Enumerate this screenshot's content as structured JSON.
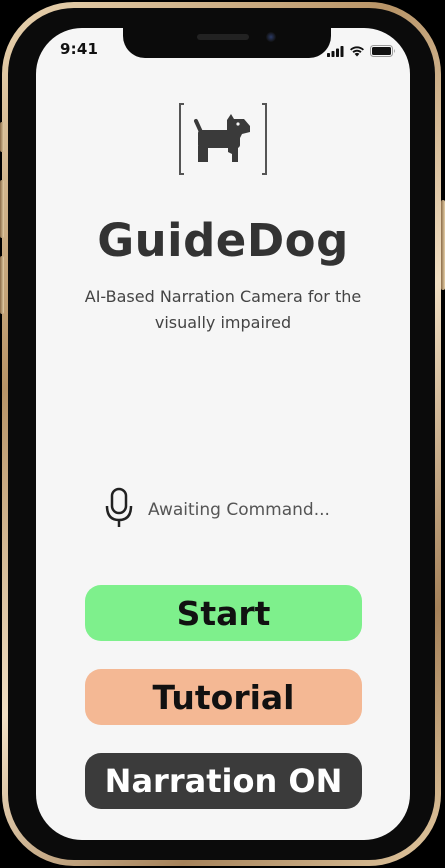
{
  "status_bar": {
    "time": "9:41",
    "icons": [
      "cellular-signal-icon",
      "wifi-icon",
      "battery-icon"
    ]
  },
  "app": {
    "logo_icon": "dog-icon",
    "title": "GuideDog",
    "subtitle": "AI-Based Narration Camera for the visually impaired"
  },
  "voice": {
    "icon": "microphone-icon",
    "status_text": "Awaiting Command..."
  },
  "buttons": {
    "start_label": "Start",
    "tutorial_label": "Tutorial",
    "narration_label": "Narration ON"
  },
  "colors": {
    "start": "#7ef08c",
    "tutorial": "#f4b894",
    "narration": "#3b3b3b",
    "screen_background": "#f6f6f6",
    "title": "#333333"
  }
}
